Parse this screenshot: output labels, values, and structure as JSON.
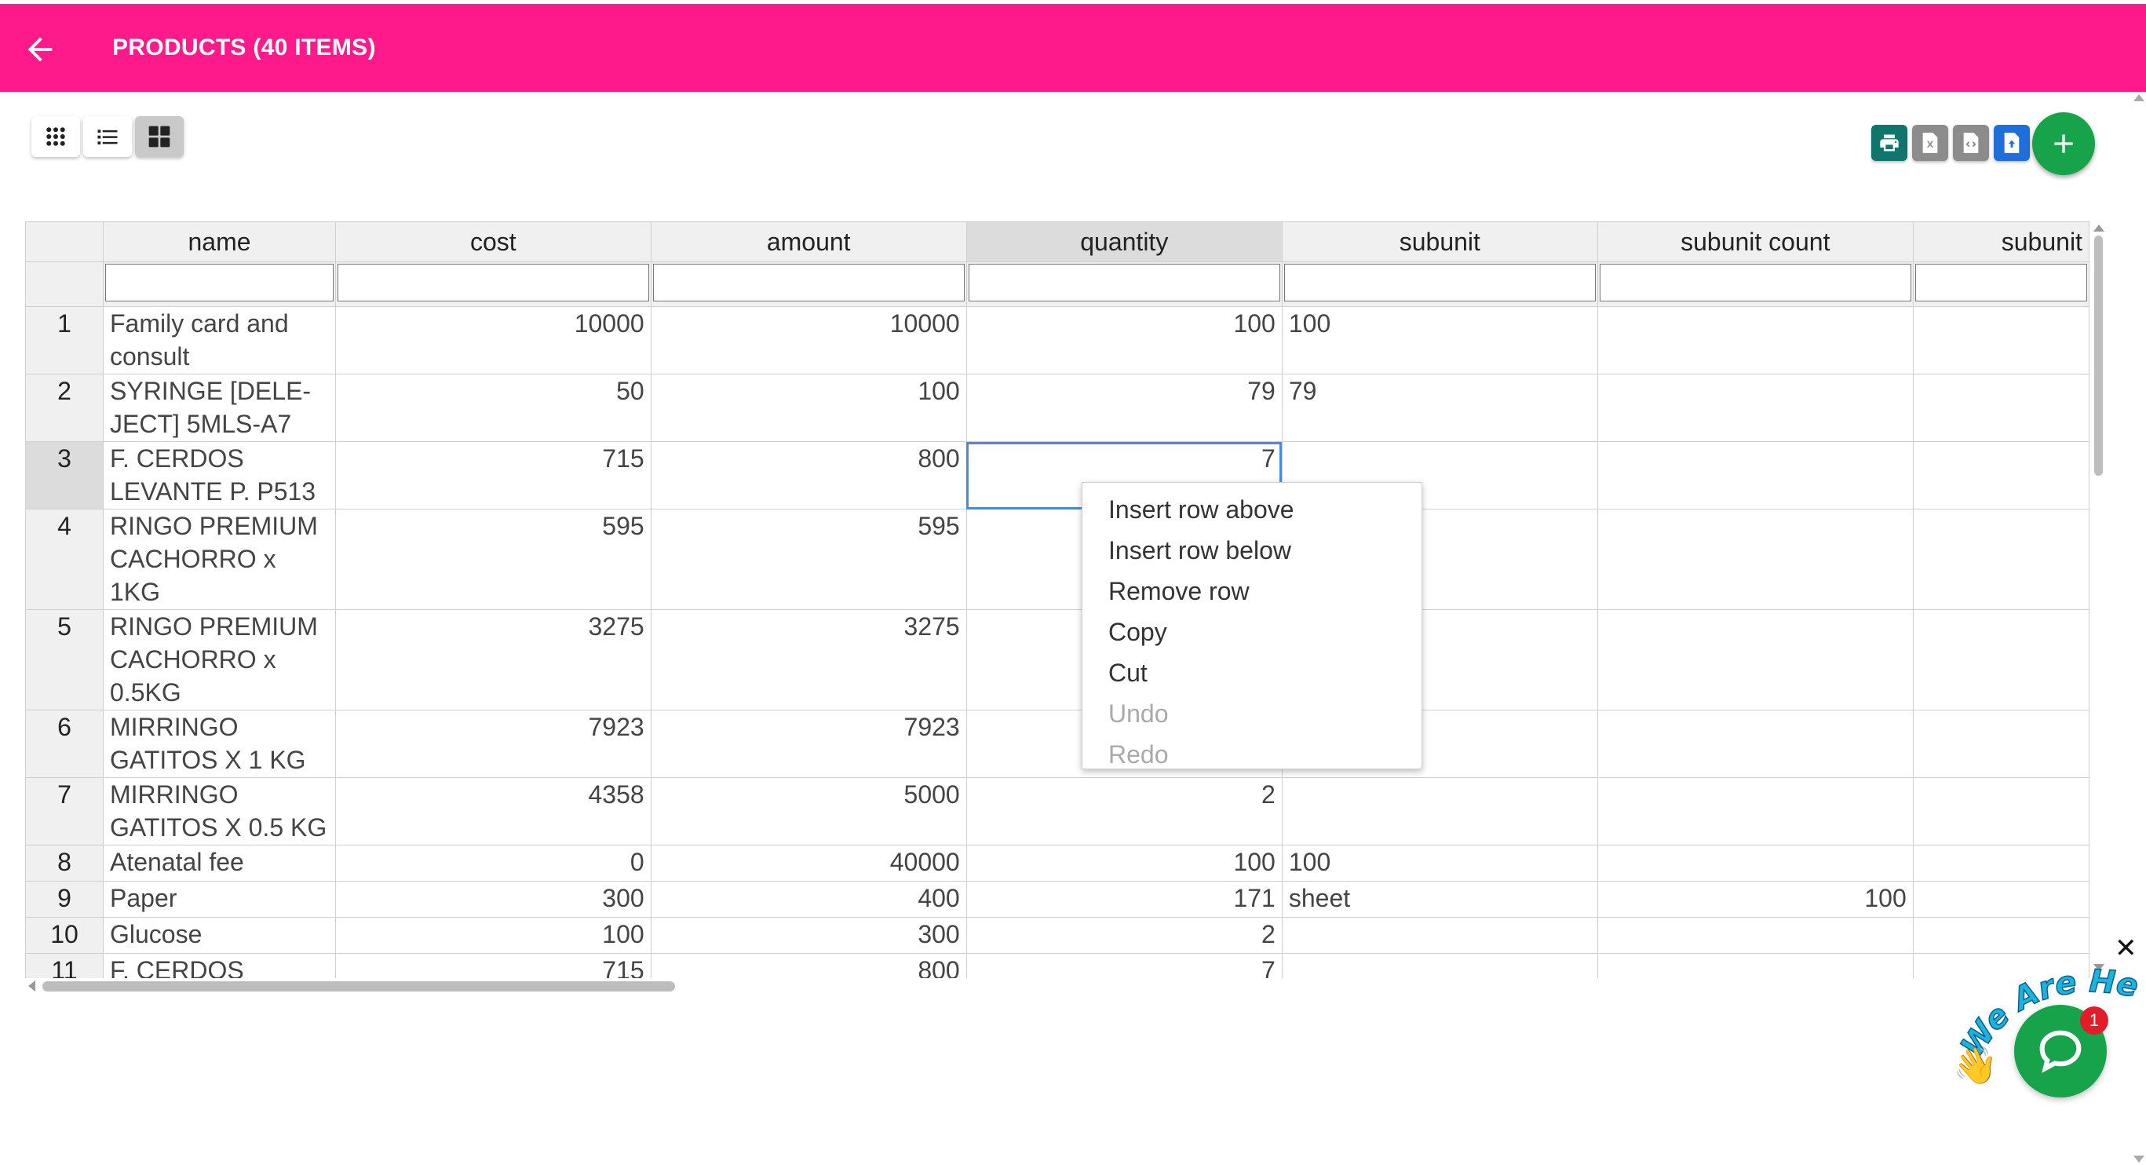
{
  "header": {
    "title": "PRODUCTS (40 ITEMS)"
  },
  "colors": {
    "appbar": "#ff1a8c",
    "fab": "#16a34a",
    "print_btn": "#0f766e",
    "grey_btn": "#8c8c8c",
    "blue_btn": "#1e6fd9",
    "active_cell": "#4b89dc"
  },
  "view_toggles": [
    {
      "icon": "grid-dots-icon"
    },
    {
      "icon": "list-icon"
    },
    {
      "icon": "grid-squares-icon",
      "active": true
    }
  ],
  "actions": [
    {
      "icon": "print-icon"
    },
    {
      "icon": "excel-file-icon"
    },
    {
      "icon": "code-file-icon"
    },
    {
      "icon": "upload-file-icon"
    }
  ],
  "table": {
    "columns": [
      "name",
      "cost",
      "amount",
      "quantity",
      "subunit",
      "subunit count",
      "subunit"
    ],
    "rows": [
      {
        "num": "1",
        "name": "Family card and consult",
        "cost": "10000",
        "amount": "10000",
        "quantity": "100",
        "subunit": "100",
        "subunit_count": ""
      },
      {
        "num": "2",
        "name": "SYRINGE [DELE-JECT] 5MLS-A7",
        "cost": "50",
        "amount": "100",
        "quantity": "79",
        "subunit": "79",
        "subunit_count": ""
      },
      {
        "num": "3",
        "name": "F. CERDOS LEVANTE P. P513",
        "cost": "715",
        "amount": "800",
        "quantity": "7",
        "subunit": "",
        "subunit_count": ""
      },
      {
        "num": "4",
        "name": "RINGO PREMIUM CACHORRO x 1KG",
        "cost": "595",
        "amount": "595",
        "quantity": "",
        "subunit": "",
        "subunit_count": ""
      },
      {
        "num": "5",
        "name": "RINGO PREMIUM CACHORRO x 0.5KG",
        "cost": "3275",
        "amount": "3275",
        "quantity": "",
        "subunit": "",
        "subunit_count": ""
      },
      {
        "num": "6",
        "name": "MIRRINGO GATITOS X 1 KG",
        "cost": "7923",
        "amount": "7923",
        "quantity": "",
        "subunit": "",
        "subunit_count": ""
      },
      {
        "num": "7",
        "name": "MIRRINGO GATITOS X 0.5 KG",
        "cost": "4358",
        "amount": "5000",
        "quantity": "2",
        "subunit": "",
        "subunit_count": ""
      },
      {
        "num": "8",
        "name": "Atenatal fee",
        "cost": "0",
        "amount": "40000",
        "quantity": "100",
        "subunit": "100",
        "subunit_count": ""
      },
      {
        "num": "9",
        "name": "Paper",
        "cost": "300",
        "amount": "400",
        "quantity": "171",
        "subunit": "sheet",
        "subunit_count": "100"
      },
      {
        "num": "10",
        "name": "Glucose",
        "cost": "100",
        "amount": "300",
        "quantity": "2",
        "subunit": "",
        "subunit_count": ""
      },
      {
        "num": "11",
        "name": "F. CERDOS",
        "cost": "715",
        "amount": "800",
        "quantity": "7",
        "subunit": "",
        "subunit_count": ""
      }
    ]
  },
  "context_menu": {
    "items": [
      {
        "label": "Insert row above",
        "disabled": false
      },
      {
        "label": "Insert row below",
        "disabled": false
      },
      {
        "label": "Remove row",
        "disabled": false
      },
      {
        "label": "Copy",
        "disabled": false
      },
      {
        "label": "Cut",
        "disabled": false
      },
      {
        "label": "Undo",
        "disabled": true
      },
      {
        "label": "Redo",
        "disabled": true
      }
    ]
  },
  "chat": {
    "badge": "1",
    "tagline": "We Are Here!",
    "close_icon": "close-icon"
  }
}
